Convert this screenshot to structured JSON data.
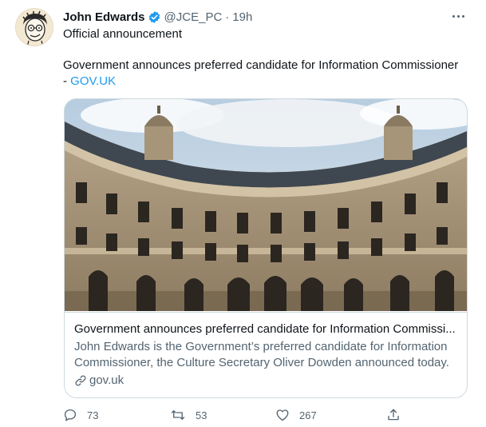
{
  "tweet": {
    "author_name": "John Edwards",
    "handle": "@JCE_PC",
    "separator": "·",
    "time": "19h",
    "text_line1": "Official announcement",
    "text_line2": "Government announces preferred candidate for Information Commissioner",
    "text_line3_prefix": "- ",
    "text_link": "GOV.UK"
  },
  "card": {
    "title": "Government announces preferred candidate for Information Commissi...",
    "description": "John Edwards is the Government’s preferred candidate for Information Commissioner, the Culture Secretary Oliver Dowden announced today.",
    "domain": "gov.uk"
  },
  "actions": {
    "reply_count": "73",
    "retweet_count": "53",
    "like_count": "267"
  },
  "colors": {
    "accent": "#1d9bf0",
    "text": "#0f1419",
    "secondary": "#536471",
    "border": "#cfd9de"
  },
  "icons": [
    "verified-badge-icon",
    "more-options-icon",
    "link-icon",
    "reply-icon",
    "retweet-icon",
    "like-icon",
    "share-icon"
  ]
}
